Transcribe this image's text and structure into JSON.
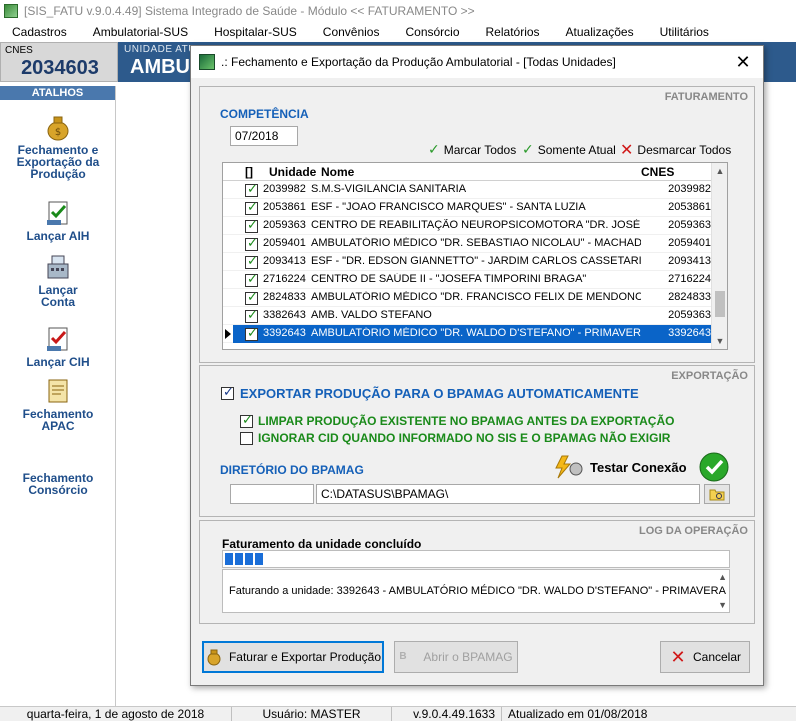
{
  "window": {
    "title": "[SIS_FATU v.9.0.4.49] Sistema Integrado de Saúde - Módulo << FATURAMENTO >>"
  },
  "menu": [
    "Cadastros",
    "Ambulatorial-SUS",
    "Hospitalar-SUS",
    "Convênios",
    "Consórcio",
    "Relatórios",
    "Atualizações",
    "Utilitários"
  ],
  "cnes": {
    "label": "CNES",
    "value": "2034603"
  },
  "banner": {
    "small": "UNIDADE ATU",
    "big": "AMBUL"
  },
  "sidebar": {
    "header": "ATALHOS",
    "items": [
      {
        "label": "Fechamento e Exportação da Produção",
        "icon": "money-bag-icon"
      },
      {
        "label": "Lançar AIH",
        "icon": "checklist-icon"
      },
      {
        "label": "Lançar Conta",
        "icon": "cash-register-icon"
      },
      {
        "label": "Lançar CIH",
        "icon": "checklist-red-icon"
      },
      {
        "label": "Fechamento APAC",
        "icon": "stamp-icon"
      },
      {
        "label": "Fechamento Consórcio",
        "icon": "blank-icon"
      }
    ]
  },
  "dialog": {
    "title": ".: Fechamento e Exportação da Produção Ambulatorial - [Todas Unidades]",
    "faturamento": {
      "tag": "FATURAMENTO",
      "competencia_label": "COMPETÊNCIA",
      "competencia_value": "07/2018",
      "mark_all": "Marcar Todos",
      "only_current": "Somente Atual",
      "unmark_all": "Desmarcar Todos",
      "columns": {
        "check": "[]",
        "unidade": "Unidade",
        "nome": "Nome",
        "cnes": "CNES"
      },
      "rows": [
        {
          "unidade": "2039982",
          "nome": "S.M.S-VIGILANCIA SANITARIA",
          "cnes": "2039982",
          "checked": true,
          "selected": false
        },
        {
          "unidade": "2053861",
          "nome": "ESF - \"JOAO FRANCISCO MARQUES\" - SANTA LUZIA",
          "cnes": "2053861",
          "checked": true,
          "selected": false
        },
        {
          "unidade": "2059363",
          "nome": "CENTRO DE REABILITAÇÃO NEUROPSICOMOTORA \"DR. JOSÉ AE",
          "cnes": "2059363",
          "checked": true,
          "selected": false
        },
        {
          "unidade": "2059401",
          "nome": "AMBULATÓRIO MÉDICO \"DR. SEBASTIAO NICOLAU\" - MACHADO",
          "cnes": "2059401",
          "checked": true,
          "selected": false
        },
        {
          "unidade": "2093413",
          "nome": "ESF - \"DR. EDSON GIANNETTO\" - JARDIM CARLOS CASSETARI",
          "cnes": "2093413",
          "checked": true,
          "selected": false
        },
        {
          "unidade": "2716224",
          "nome": "CENTRO DE SAÚDE II - \"JOSEFA TIMPORINI BRAGA\"",
          "cnes": "2716224",
          "checked": true,
          "selected": false
        },
        {
          "unidade": "2824833",
          "nome": "AMBULATÓRIO MÉDICO \"DR. FRANCISCO FELIX DE MENDONCA\"",
          "cnes": "2824833",
          "checked": true,
          "selected": false
        },
        {
          "unidade": "3382643",
          "nome": "AMB. VALDO STEFANO",
          "cnes": "2059363",
          "checked": true,
          "selected": false
        },
        {
          "unidade": "3392643",
          "nome": "AMBULATÓRIO MÉDICO \"DR. WALDO D'STEFANO\" - PRIMAVERA",
          "cnes": "3392643",
          "checked": true,
          "selected": true
        }
      ]
    },
    "exportacao": {
      "tag": "EXPORTAÇÃO",
      "auto_export_label": "EXPORTAR PRODUÇÃO PARA O BPAMAG AUTOMATICAMENTE",
      "auto_export_checked": true,
      "clear_label": "LIMPAR PRODUÇÃO EXISTENTE NO BPAMAG ANTES DA EXPORTAÇÃO",
      "clear_checked": true,
      "ignore_cid_label": "IGNORAR CID QUANDO INFORMADO NO SIS E O BPAMAG NÃO EXIGIR",
      "ignore_cid_checked": false,
      "dir_label": "DIRETÓRIO DO BPAMAG",
      "test_connection": "Testar Conexão",
      "drive_value": "",
      "dir_value": "C:\\DATASUS\\BPAMAG\\"
    },
    "log": {
      "tag": "LOG DA OPERAÇÃO",
      "status": "Faturamento da unidade concluído",
      "progress": 0.08,
      "message": "Faturando a unidade: 3392643 - AMBULATÓRIO MÉDICO \"DR. WALDO D'STEFANO\" - PRIMAVERA"
    },
    "buttons": {
      "faturar": "Faturar e Exportar Produção",
      "abrir": "Abrir o BPAMAG",
      "cancelar": "Cancelar"
    }
  },
  "statusbar": {
    "date": "quarta-feira, 1 de agosto de 2018",
    "user": "Usuário: MASTER",
    "version": "v.9.0.4.49.1633",
    "updated": "Atualizado em 01/08/2018"
  },
  "colors": {
    "accent_blue": "#1560b8",
    "selection": "#0a64c8",
    "green": "#1a8a1a",
    "banner": "#2d5a8c"
  }
}
